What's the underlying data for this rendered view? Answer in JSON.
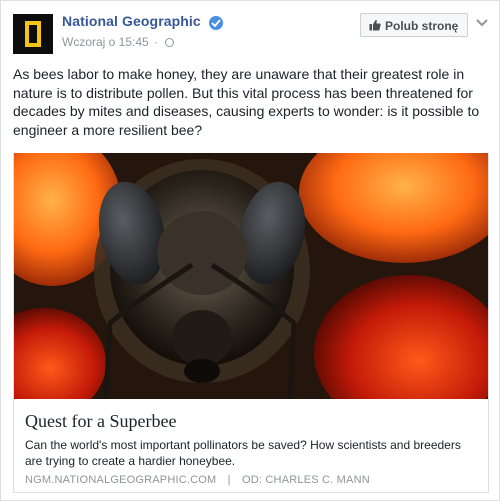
{
  "post": {
    "page_name": "National Geographic",
    "timestamp": "Wczoraj o 15:45",
    "meta_separator": "·",
    "like_page_label": "Polub stronę",
    "text": "As bees labor to make honey, they are unaware that their greatest role in nature is to distribute pollen. But this vital process has been threatened for decades by mites and diseases, causing experts to wonder: is it possible to engineer a more resilient bee?"
  },
  "link_card": {
    "title": "Quest for a Superbee",
    "description": "Can the world's most important pollinators be saved? How scientists and breeders are trying to create a hardier honeybee.",
    "domain": "NGM.NATIONALGEOGRAPHIC.COM",
    "separator": "|",
    "author": "OD: CHARLES C. MANN"
  },
  "icons": {
    "avatar": "national-geographic-logo",
    "verified": "verified-badge-icon",
    "privacy": "globe-icon",
    "like": "thumbs-up-icon",
    "options": "chevron-down-icon"
  },
  "colors": {
    "link_blue": "#365899",
    "verified_blue": "#4a90e2",
    "natgeo_yellow": "#f5c417",
    "meta_gray": "#90949c"
  }
}
